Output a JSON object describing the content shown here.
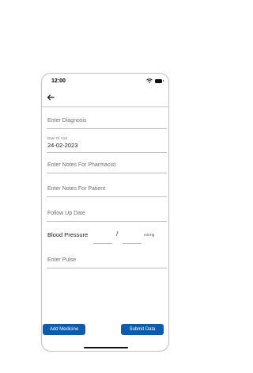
{
  "status_bar": {
    "time": "12:00"
  },
  "nav": {
    "back_icon": "arrow-left-icon"
  },
  "form": {
    "diagnosis_placeholder": "Enter Diagnosis",
    "date_of_visit_label": "Date Of Visit",
    "date_of_visit_value": "24-02-2023",
    "notes_pharmacist_placeholder": "Enter Notes For Pharmacist",
    "notes_patient_placeholder": "Enter Notes For Patient",
    "follow_up_placeholder": "Follow Up Date",
    "blood_pressure_label": "Blood Pressure",
    "blood_pressure_separator": "/",
    "blood_pressure_unit": "mmHg",
    "pulse_placeholder": "Enter Pulse"
  },
  "actions": {
    "add_medicine_label": "Add Medicine",
    "submit_label": "Submit Data",
    "button_color": "#0d5cac"
  }
}
